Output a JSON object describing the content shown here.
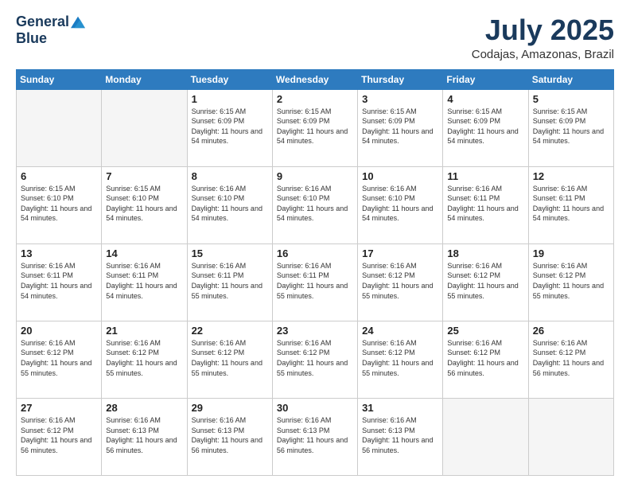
{
  "header": {
    "logo_general": "General",
    "logo_blue": "Blue",
    "month": "July 2025",
    "location": "Codajas, Amazonas, Brazil"
  },
  "weekdays": [
    "Sunday",
    "Monday",
    "Tuesday",
    "Wednesday",
    "Thursday",
    "Friday",
    "Saturday"
  ],
  "weeks": [
    [
      {
        "day": "",
        "info": ""
      },
      {
        "day": "",
        "info": ""
      },
      {
        "day": "1",
        "info": "Sunrise: 6:15 AM\nSunset: 6:09 PM\nDaylight: 11 hours and 54 minutes."
      },
      {
        "day": "2",
        "info": "Sunrise: 6:15 AM\nSunset: 6:09 PM\nDaylight: 11 hours and 54 minutes."
      },
      {
        "day": "3",
        "info": "Sunrise: 6:15 AM\nSunset: 6:09 PM\nDaylight: 11 hours and 54 minutes."
      },
      {
        "day": "4",
        "info": "Sunrise: 6:15 AM\nSunset: 6:09 PM\nDaylight: 11 hours and 54 minutes."
      },
      {
        "day": "5",
        "info": "Sunrise: 6:15 AM\nSunset: 6:09 PM\nDaylight: 11 hours and 54 minutes."
      }
    ],
    [
      {
        "day": "6",
        "info": "Sunrise: 6:15 AM\nSunset: 6:10 PM\nDaylight: 11 hours and 54 minutes."
      },
      {
        "day": "7",
        "info": "Sunrise: 6:15 AM\nSunset: 6:10 PM\nDaylight: 11 hours and 54 minutes."
      },
      {
        "day": "8",
        "info": "Sunrise: 6:16 AM\nSunset: 6:10 PM\nDaylight: 11 hours and 54 minutes."
      },
      {
        "day": "9",
        "info": "Sunrise: 6:16 AM\nSunset: 6:10 PM\nDaylight: 11 hours and 54 minutes."
      },
      {
        "day": "10",
        "info": "Sunrise: 6:16 AM\nSunset: 6:10 PM\nDaylight: 11 hours and 54 minutes."
      },
      {
        "day": "11",
        "info": "Sunrise: 6:16 AM\nSunset: 6:11 PM\nDaylight: 11 hours and 54 minutes."
      },
      {
        "day": "12",
        "info": "Sunrise: 6:16 AM\nSunset: 6:11 PM\nDaylight: 11 hours and 54 minutes."
      }
    ],
    [
      {
        "day": "13",
        "info": "Sunrise: 6:16 AM\nSunset: 6:11 PM\nDaylight: 11 hours and 54 minutes."
      },
      {
        "day": "14",
        "info": "Sunrise: 6:16 AM\nSunset: 6:11 PM\nDaylight: 11 hours and 54 minutes."
      },
      {
        "day": "15",
        "info": "Sunrise: 6:16 AM\nSunset: 6:11 PM\nDaylight: 11 hours and 55 minutes."
      },
      {
        "day": "16",
        "info": "Sunrise: 6:16 AM\nSunset: 6:11 PM\nDaylight: 11 hours and 55 minutes."
      },
      {
        "day": "17",
        "info": "Sunrise: 6:16 AM\nSunset: 6:12 PM\nDaylight: 11 hours and 55 minutes."
      },
      {
        "day": "18",
        "info": "Sunrise: 6:16 AM\nSunset: 6:12 PM\nDaylight: 11 hours and 55 minutes."
      },
      {
        "day": "19",
        "info": "Sunrise: 6:16 AM\nSunset: 6:12 PM\nDaylight: 11 hours and 55 minutes."
      }
    ],
    [
      {
        "day": "20",
        "info": "Sunrise: 6:16 AM\nSunset: 6:12 PM\nDaylight: 11 hours and 55 minutes."
      },
      {
        "day": "21",
        "info": "Sunrise: 6:16 AM\nSunset: 6:12 PM\nDaylight: 11 hours and 55 minutes."
      },
      {
        "day": "22",
        "info": "Sunrise: 6:16 AM\nSunset: 6:12 PM\nDaylight: 11 hours and 55 minutes."
      },
      {
        "day": "23",
        "info": "Sunrise: 6:16 AM\nSunset: 6:12 PM\nDaylight: 11 hours and 55 minutes."
      },
      {
        "day": "24",
        "info": "Sunrise: 6:16 AM\nSunset: 6:12 PM\nDaylight: 11 hours and 55 minutes."
      },
      {
        "day": "25",
        "info": "Sunrise: 6:16 AM\nSunset: 6:12 PM\nDaylight: 11 hours and 56 minutes."
      },
      {
        "day": "26",
        "info": "Sunrise: 6:16 AM\nSunset: 6:12 PM\nDaylight: 11 hours and 56 minutes."
      }
    ],
    [
      {
        "day": "27",
        "info": "Sunrise: 6:16 AM\nSunset: 6:12 PM\nDaylight: 11 hours and 56 minutes."
      },
      {
        "day": "28",
        "info": "Sunrise: 6:16 AM\nSunset: 6:13 PM\nDaylight: 11 hours and 56 minutes."
      },
      {
        "day": "29",
        "info": "Sunrise: 6:16 AM\nSunset: 6:13 PM\nDaylight: 11 hours and 56 minutes."
      },
      {
        "day": "30",
        "info": "Sunrise: 6:16 AM\nSunset: 6:13 PM\nDaylight: 11 hours and 56 minutes."
      },
      {
        "day": "31",
        "info": "Sunrise: 6:16 AM\nSunset: 6:13 PM\nDaylight: 11 hours and 56 minutes."
      },
      {
        "day": "",
        "info": ""
      },
      {
        "day": "",
        "info": ""
      }
    ]
  ]
}
